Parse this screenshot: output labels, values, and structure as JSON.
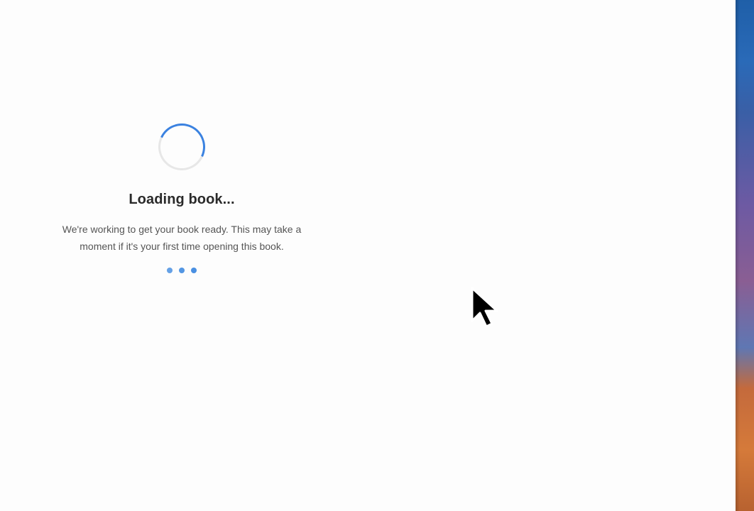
{
  "loading": {
    "title": "Loading book...",
    "message": "We're working to get your book ready. This may take a moment if it's your first time opening this book."
  },
  "icons": {
    "spinner": "loading-spinner-icon",
    "dots": "loading-dots-icon",
    "cursor": "mouse-pointer-icon"
  },
  "colors": {
    "accent": "#3b82e0",
    "dots": "#4a90e2",
    "title": "#2a2a2a",
    "message": "#555555",
    "background": "#fdfdfd"
  }
}
